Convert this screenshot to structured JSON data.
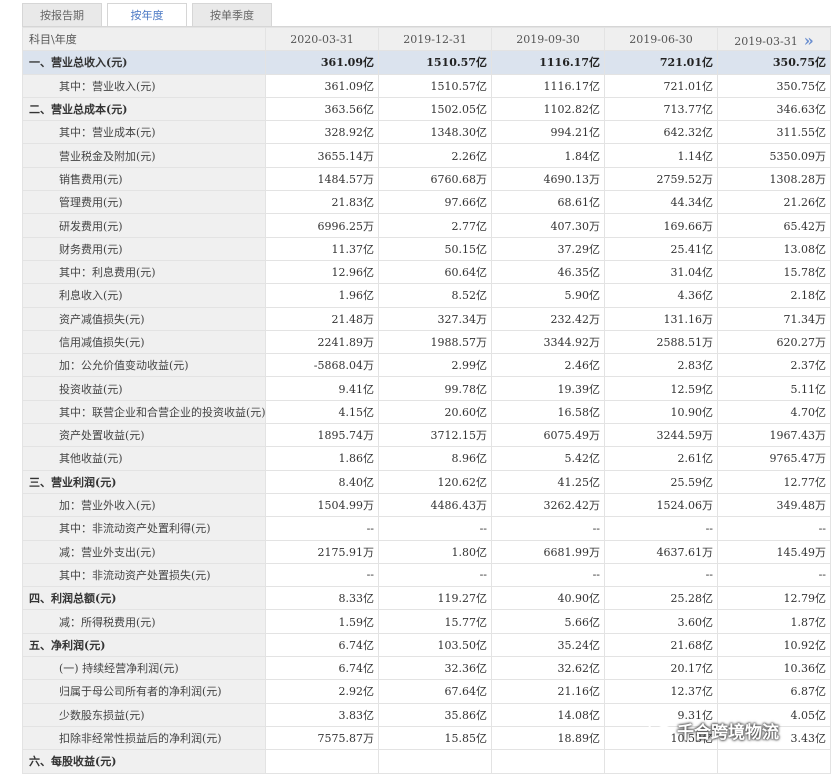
{
  "tabs": [
    {
      "label": "按报告期"
    },
    {
      "label": "按年度"
    },
    {
      "label": "按单季度"
    }
  ],
  "table": {
    "header_label": "科目\\年度",
    "columns": [
      "2020-03-31",
      "2019-12-31",
      "2019-09-30",
      "2019-06-30",
      "2019-03-31"
    ],
    "more_glyph": "»",
    "rows": [
      {
        "label": "一、营业总收入(元)",
        "values": [
          "361.09亿",
          "1510.57亿",
          "1116.17亿",
          "721.01亿",
          "350.75亿"
        ]
      },
      {
        "label": "其中：营业收入(元)",
        "values": [
          "361.09亿",
          "1510.57亿",
          "1116.17亿",
          "721.01亿",
          "350.75亿"
        ]
      },
      {
        "label": "二、营业总成本(元)",
        "values": [
          "363.56亿",
          "1502.05亿",
          "1102.82亿",
          "713.77亿",
          "346.63亿"
        ]
      },
      {
        "label": "其中：营业成本(元)",
        "values": [
          "328.92亿",
          "1348.30亿",
          "994.21亿",
          "642.32亿",
          "311.55亿"
        ]
      },
      {
        "label": "营业税金及附加(元)",
        "values": [
          "3655.14万",
          "2.26亿",
          "1.84亿",
          "1.14亿",
          "5350.09万"
        ]
      },
      {
        "label": "销售费用(元)",
        "values": [
          "1484.57万",
          "6760.68万",
          "4690.13万",
          "2759.52万",
          "1308.28万"
        ]
      },
      {
        "label": "管理费用(元)",
        "values": [
          "21.83亿",
          "97.66亿",
          "68.61亿",
          "44.34亿",
          "21.26亿"
        ]
      },
      {
        "label": "研发费用(元)",
        "values": [
          "6996.25万",
          "2.77亿",
          "407.30万",
          "169.66万",
          "65.42万"
        ]
      },
      {
        "label": "财务费用(元)",
        "values": [
          "11.37亿",
          "50.15亿",
          "37.29亿",
          "25.41亿",
          "13.08亿"
        ]
      },
      {
        "label": "其中：利息费用(元)",
        "values": [
          "12.96亿",
          "60.64亿",
          "46.35亿",
          "31.04亿",
          "15.78亿"
        ]
      },
      {
        "label": "利息收入(元)",
        "values": [
          "1.96亿",
          "8.52亿",
          "5.90亿",
          "4.36亿",
          "2.18亿"
        ]
      },
      {
        "label": "资产减值损失(元)",
        "values": [
          "21.48万",
          "327.34万",
          "232.42万",
          "131.16万",
          "71.34万"
        ]
      },
      {
        "label": "信用减值损失(元)",
        "values": [
          "2241.89万",
          "1988.57万",
          "3344.92万",
          "2588.51万",
          "620.27万"
        ]
      },
      {
        "label": "加：公允价值变动收益(元)",
        "values": [
          "-5868.04万",
          "2.99亿",
          "2.46亿",
          "2.83亿",
          "2.37亿"
        ]
      },
      {
        "label": "投资收益(元)",
        "values": [
          "9.41亿",
          "99.78亿",
          "19.39亿",
          "12.59亿",
          "5.11亿"
        ]
      },
      {
        "label": "其中：联营企业和合营企业的投资收益(元)",
        "values": [
          "4.15亿",
          "20.60亿",
          "16.58亿",
          "10.90亿",
          "4.70亿"
        ]
      },
      {
        "label": "资产处置收益(元)",
        "values": [
          "1895.74万",
          "3712.15万",
          "6075.49万",
          "3244.59万",
          "1967.43万"
        ]
      },
      {
        "label": "其他收益(元)",
        "values": [
          "1.86亿",
          "8.96亿",
          "5.42亿",
          "2.61亿",
          "9765.47万"
        ]
      },
      {
        "label": "三、营业利润(元)",
        "values": [
          "8.40亿",
          "120.62亿",
          "41.25亿",
          "25.59亿",
          "12.77亿"
        ]
      },
      {
        "label": "加：营业外收入(元)",
        "values": [
          "1504.99万",
          "4486.43万",
          "3262.42万",
          "1524.06万",
          "349.48万"
        ]
      },
      {
        "label": "其中：非流动资产处置利得(元)",
        "values": [
          "--",
          "--",
          "--",
          "--",
          "--"
        ]
      },
      {
        "label": "减：营业外支出(元)",
        "values": [
          "2175.91万",
          "1.80亿",
          "6681.99万",
          "4637.61万",
          "145.49万"
        ]
      },
      {
        "label": "其中：非流动资产处置损失(元)",
        "values": [
          "--",
          "--",
          "--",
          "--",
          "--"
        ]
      },
      {
        "label": "四、利润总额(元)",
        "values": [
          "8.33亿",
          "119.27亿",
          "40.90亿",
          "25.28亿",
          "12.79亿"
        ]
      },
      {
        "label": "减：所得税费用(元)",
        "values": [
          "1.59亿",
          "15.77亿",
          "5.66亿",
          "3.60亿",
          "1.87亿"
        ]
      },
      {
        "label": "五、净利润(元)",
        "values": [
          "6.74亿",
          "103.50亿",
          "35.24亿",
          "21.68亿",
          "10.92亿"
        ]
      },
      {
        "label": "(一) 持续经营净利润(元)",
        "values": [
          "6.74亿",
          "32.36亿",
          "32.62亿",
          "20.17亿",
          "10.36亿"
        ]
      },
      {
        "label": "归属于母公司所有者的净利润(元)",
        "values": [
          "2.92亿",
          "67.64亿",
          "21.16亿",
          "12.37亿",
          "6.87亿"
        ]
      },
      {
        "label": "少数股东损益(元)",
        "values": [
          "3.83亿",
          "35.86亿",
          "14.08亿",
          "9.31亿",
          "4.05亿"
        ]
      },
      {
        "label": "扣除非经常性损益后的净利润(元)",
        "values": [
          "7575.87万",
          "15.85亿",
          "18.89亿",
          "10.53亿",
          "3.43亿"
        ]
      },
      {
        "label": "六、每股收益(元)",
        "values": [
          "",
          "",
          "",
          "",
          ""
        ]
      }
    ]
  },
  "watermark": {
    "text": "千合跨境物流",
    "icon": "wechat-icon"
  }
}
